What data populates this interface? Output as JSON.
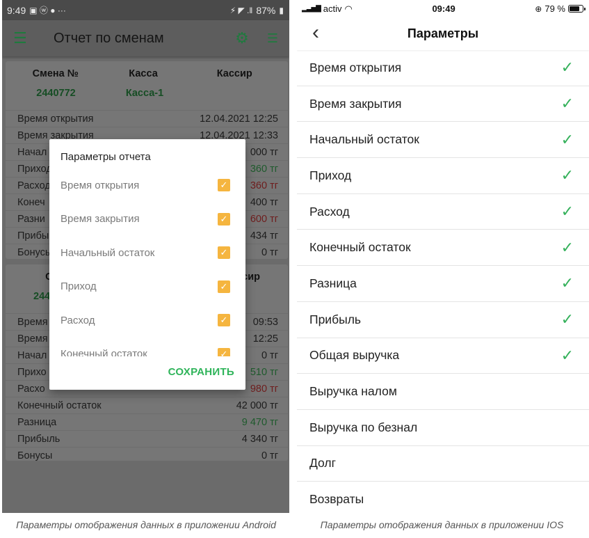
{
  "android": {
    "status_bar": {
      "time": "9:49",
      "left_icons": "▣ ⓦ ● ···",
      "right_icons": "⚡ ◤ .‖",
      "battery": "87%"
    },
    "app_bar": {
      "title": "Отчет по сменам"
    },
    "table_headers": [
      "Смена №",
      "Касса",
      "Кассир"
    ],
    "shift1": {
      "shift_no": "2440772",
      "cashbox": "Касса-1",
      "rows": [
        {
          "label": "Время открытия",
          "value": "12.04.2021 12:25",
          "tone": ""
        },
        {
          "label": "Время закрытия",
          "value": "12.04.2021 12:33",
          "tone": ""
        },
        {
          "label": "Начал",
          "value": "000 тг",
          "tone": ""
        },
        {
          "label": "Приход",
          "value": "360 тг",
          "tone": "green"
        },
        {
          "label": "Расход",
          "value": "360 тг",
          "tone": "red"
        },
        {
          "label": "Конеч",
          "value": "400 тг",
          "tone": ""
        },
        {
          "label": "Разни",
          "value": "600 тг",
          "tone": "red"
        },
        {
          "label": "Прибы",
          "value": "434 тг",
          "tone": ""
        },
        {
          "label": "Бонусы",
          "value": "0 тг",
          "tone": ""
        }
      ]
    },
    "shift2": {
      "header_left": "Сме",
      "header_right": "сир",
      "shift_no": "244",
      "rows": [
        {
          "label": "Время",
          "value": "09:53",
          "tone": ""
        },
        {
          "label": "Время",
          "value": "12:25",
          "tone": ""
        },
        {
          "label": "Начал",
          "value": "0 тг",
          "tone": ""
        },
        {
          "label": "Прихо",
          "value": "510 тг",
          "tone": "green"
        },
        {
          "label": "Расхо",
          "value": "980 тг",
          "tone": "red"
        },
        {
          "label": "Конечный остаток",
          "value": "42 000 тг",
          "tone": ""
        },
        {
          "label": "Разница",
          "value": "9 470 тг",
          "tone": "green"
        },
        {
          "label": "Прибыль",
          "value": "4 340 тг",
          "tone": ""
        },
        {
          "label": "Бонусы",
          "value": "0 тг",
          "tone": ""
        }
      ]
    },
    "dialog": {
      "title": "Параметры отчета",
      "options": [
        {
          "label": "Время открытия",
          "checked": true
        },
        {
          "label": "Время закрытия",
          "checked": true
        },
        {
          "label": "Начальный остаток",
          "checked": true
        },
        {
          "label": "Приход",
          "checked": true
        },
        {
          "label": "Расход",
          "checked": true
        },
        {
          "label": "Конечный остаток",
          "checked": true
        }
      ],
      "save_label": "СОХРАНИТЬ"
    }
  },
  "ios": {
    "status_bar": {
      "carrier": "activ",
      "time": "09:49",
      "battery": "79 %"
    },
    "nav": {
      "title": "Параметры"
    },
    "items": [
      {
        "label": "Время открытия",
        "checked": true
      },
      {
        "label": "Время закрытия",
        "checked": true
      },
      {
        "label": "Начальный остаток",
        "checked": true
      },
      {
        "label": "Приход",
        "checked": true
      },
      {
        "label": "Расход",
        "checked": true
      },
      {
        "label": "Конечный остаток",
        "checked": true
      },
      {
        "label": "Разница",
        "checked": true
      },
      {
        "label": "Прибыль",
        "checked": true
      },
      {
        "label": "Общая выручка",
        "checked": true
      },
      {
        "label": "Выручка налом",
        "checked": false
      },
      {
        "label": "Выручка по безнал",
        "checked": false
      },
      {
        "label": "Долг",
        "checked": false
      },
      {
        "label": "Возвраты",
        "checked": false
      }
    ]
  },
  "captions": {
    "android": "Параметры отображения данных в приложении Android",
    "ios": "Параметры отображения данных в приложении IOS"
  },
  "colors": {
    "accent_green": "#35b15b",
    "checkbox_orange": "#f5b53f",
    "android_overlay": "#6b6b6b"
  }
}
